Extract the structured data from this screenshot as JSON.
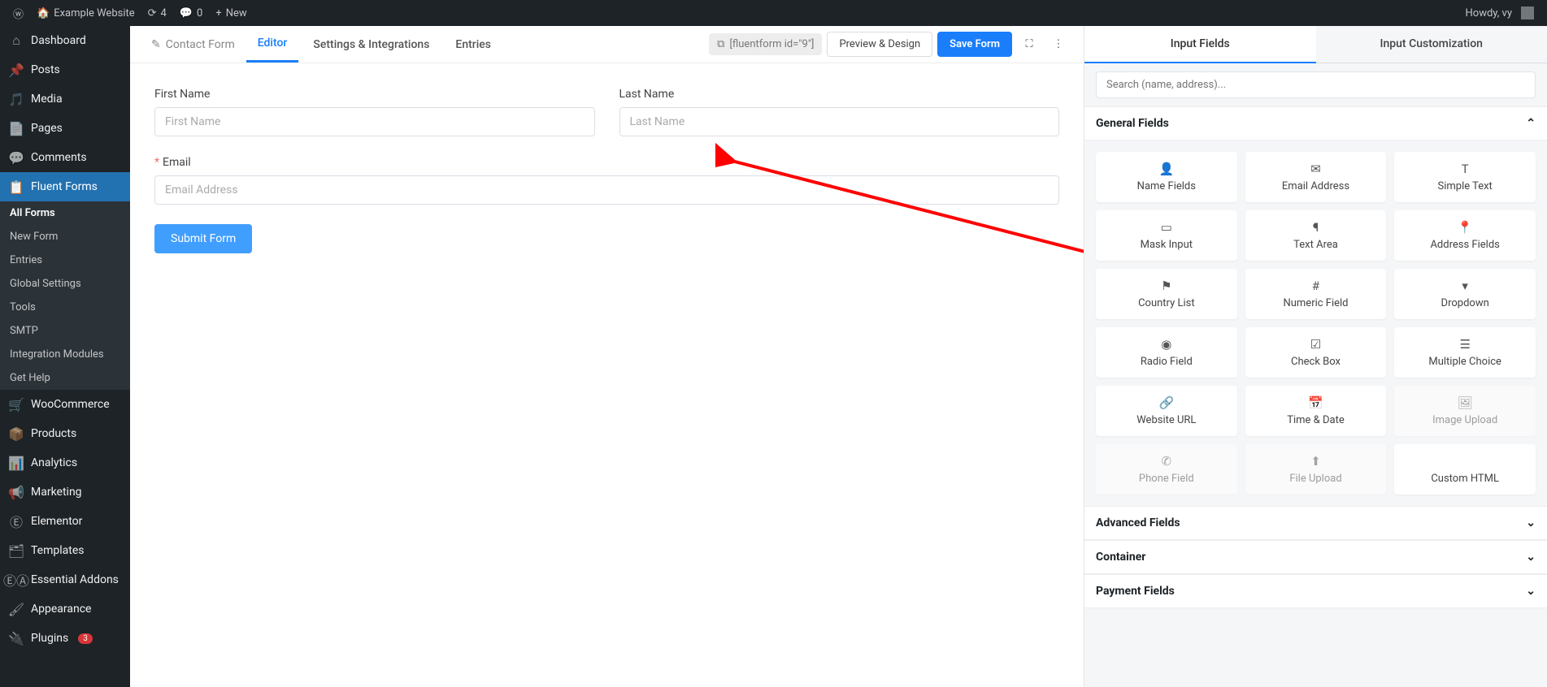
{
  "topbar": {
    "site_name": "Example Website",
    "updates": "4",
    "comments": "0",
    "new_label": "New",
    "howdy": "Howdy, vy"
  },
  "sidebar": {
    "items": [
      {
        "icon": "dashboard",
        "label": "Dashboard"
      },
      {
        "icon": "pin",
        "label": "Posts"
      },
      {
        "icon": "media",
        "label": "Media"
      },
      {
        "icon": "page",
        "label": "Pages"
      },
      {
        "icon": "comment",
        "label": "Comments"
      },
      {
        "icon": "form",
        "label": "Fluent Forms",
        "active": true
      },
      {
        "icon": "woo",
        "label": "WooCommerce"
      },
      {
        "icon": "products",
        "label": "Products"
      },
      {
        "icon": "analytics",
        "label": "Analytics"
      },
      {
        "icon": "marketing",
        "label": "Marketing"
      },
      {
        "icon": "elementor",
        "label": "Elementor"
      },
      {
        "icon": "templates",
        "label": "Templates"
      },
      {
        "icon": "ea",
        "label": "Essential Addons"
      },
      {
        "icon": "appearance",
        "label": "Appearance"
      },
      {
        "icon": "plugins",
        "label": "Plugins",
        "badge": "3"
      }
    ],
    "submenu": [
      {
        "label": "All Forms",
        "sel": true
      },
      {
        "label": "New Form"
      },
      {
        "label": "Entries"
      },
      {
        "label": "Global Settings"
      },
      {
        "label": "Tools"
      },
      {
        "label": "SMTP"
      },
      {
        "label": "Integration Modules"
      },
      {
        "label": "Get Help"
      }
    ]
  },
  "editor_header": {
    "form_name": "Contact Form",
    "tabs": [
      "Editor",
      "Settings & Integrations",
      "Entries"
    ],
    "shortcode": "[fluentform id=\"9\"]",
    "preview": "Preview & Design",
    "save": "Save Form"
  },
  "form": {
    "first_name_label": "First Name",
    "first_name_ph": "First Name",
    "last_name_label": "Last Name",
    "last_name_ph": "Last Name",
    "email_label": "Email",
    "email_ph": "Email Address",
    "submit": "Submit Form"
  },
  "panel": {
    "tab1": "Input Fields",
    "tab2": "Input Customization",
    "search_ph": "Search (name, address)...",
    "section1": "General Fields",
    "section2": "Advanced Fields",
    "section3": "Container",
    "section4": "Payment Fields",
    "cards": [
      {
        "icon": "👤",
        "label": "Name Fields"
      },
      {
        "icon": "✉",
        "label": "Email Address"
      },
      {
        "icon": "T",
        "label": "Simple Text"
      },
      {
        "icon": "▭",
        "label": "Mask Input"
      },
      {
        "icon": "¶",
        "label": "Text Area"
      },
      {
        "icon": "📍",
        "label": "Address Fields"
      },
      {
        "icon": "⚑",
        "label": "Country List"
      },
      {
        "icon": "#",
        "label": "Numeric Field"
      },
      {
        "icon": "▾",
        "label": "Dropdown"
      },
      {
        "icon": "◉",
        "label": "Radio Field"
      },
      {
        "icon": "☑",
        "label": "Check Box"
      },
      {
        "icon": "☰",
        "label": "Multiple Choice"
      },
      {
        "icon": "🔗",
        "label": "Website URL"
      },
      {
        "icon": "📅",
        "label": "Time & Date"
      },
      {
        "icon": "🖼",
        "label": "Image Upload",
        "disabled": true
      },
      {
        "icon": "✆",
        "label": "Phone Field",
        "disabled": true
      },
      {
        "icon": "⬆",
        "label": "File Upload",
        "disabled": true
      },
      {
        "icon": "</>",
        "label": "Custom HTML"
      }
    ]
  }
}
